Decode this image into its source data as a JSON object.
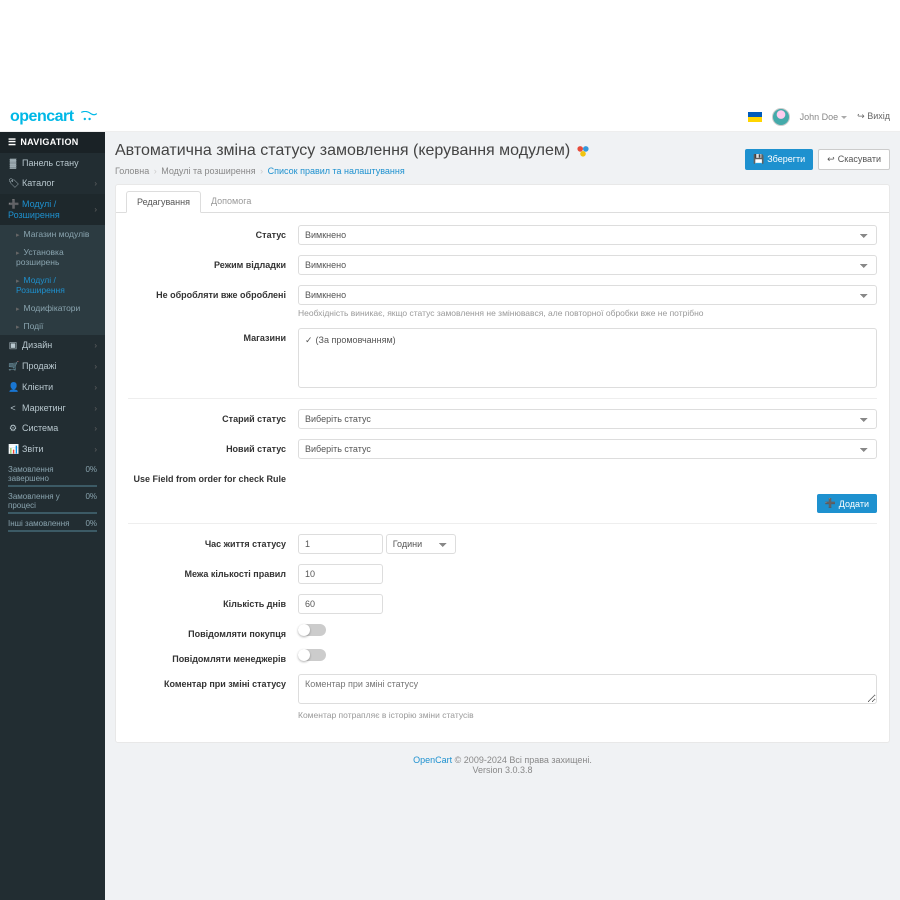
{
  "brand": "opencart",
  "user": {
    "name": "John Doe",
    "logout": "Вихід"
  },
  "nav_header": "NAVIGATION",
  "nav": [
    {
      "icon": "▓",
      "label": "Панель стану",
      "chev": false
    },
    {
      "icon": "🏷",
      "label": "Каталог",
      "chev": true
    },
    {
      "icon": "➕",
      "label": "Модулі / Розширення",
      "chev": true,
      "active": true,
      "subs": [
        {
          "label": "Магазин модулів"
        },
        {
          "label": "Установка розширень"
        },
        {
          "label": "Модулі / Розширення",
          "cur": true
        },
        {
          "label": "Модифікатори"
        },
        {
          "label": "Події"
        }
      ]
    },
    {
      "icon": "▣",
      "label": "Дизайн",
      "chev": true
    },
    {
      "icon": "🛒",
      "label": "Продажі",
      "chev": true
    },
    {
      "icon": "👤",
      "label": "Клієнти",
      "chev": true
    },
    {
      "icon": "<",
      "label": "Маркетинг",
      "chev": true
    },
    {
      "icon": "⚙",
      "label": "Система",
      "chev": true
    },
    {
      "icon": "📊",
      "label": "Звіти",
      "chev": true
    }
  ],
  "progress": [
    {
      "label": "Замовлення завершено",
      "val": "0%"
    },
    {
      "label": "Замовлення у процесі",
      "val": "0%"
    },
    {
      "label": "Інші замовлення",
      "val": "0%"
    }
  ],
  "page": {
    "title": "Автоматична зміна статусу замовлення (керування модулем)"
  },
  "breadcrumb": [
    {
      "t": "Головна"
    },
    {
      "t": "Модулі та розширення"
    },
    {
      "t": "Список правил та налаштування",
      "link": true
    }
  ],
  "buttons": {
    "save": "Зберегти",
    "cancel": "Скасувати",
    "save_icon": "💾",
    "cancel_icon": "↩",
    "add": "Додати",
    "add_icon": "➕"
  },
  "tabs": {
    "edit": "Редагування",
    "help": "Допомога"
  },
  "form": {
    "status": {
      "label": "Статус",
      "value": "Вимкнено"
    },
    "debug": {
      "label": "Режим відладки",
      "value": "Вимкнено"
    },
    "noprocess": {
      "label": "Не обробляти вже оброблені",
      "value": "Вимкнено",
      "help": "Необхідність виникає, якщо статус замовлення не змінювався, але повторної обробки вже не потрібно"
    },
    "stores": {
      "label": "Магазини",
      "default": "(За промовчанням)"
    },
    "old_status": {
      "label": "Старий статус",
      "placeholder": "Виберіть статус"
    },
    "new_status": {
      "label": "Новий статус",
      "placeholder": "Виберіть статус"
    },
    "use_field": {
      "label": "Use Field from order for check Rule"
    },
    "lifetime": {
      "label": "Час життя статусу",
      "value": "1",
      "unit": "Години"
    },
    "rules_limit": {
      "label": "Межа кількості правил",
      "value": "10"
    },
    "days": {
      "label": "Кількість днів",
      "value": "60"
    },
    "notify_buyer": {
      "label": "Повідомляти покупця"
    },
    "notify_mgr": {
      "label": "Повідомляти менеджерів"
    },
    "comment": {
      "label": "Коментар при зміні статусу",
      "placeholder": "Коментар при зміні статусу",
      "help": "Коментар потрапляє в історію зміни статусів"
    }
  },
  "footer": {
    "brand": "OpenCart",
    "copy": " © 2009-2024 Всі права захищені.",
    "version": "Version 3.0.3.8"
  }
}
